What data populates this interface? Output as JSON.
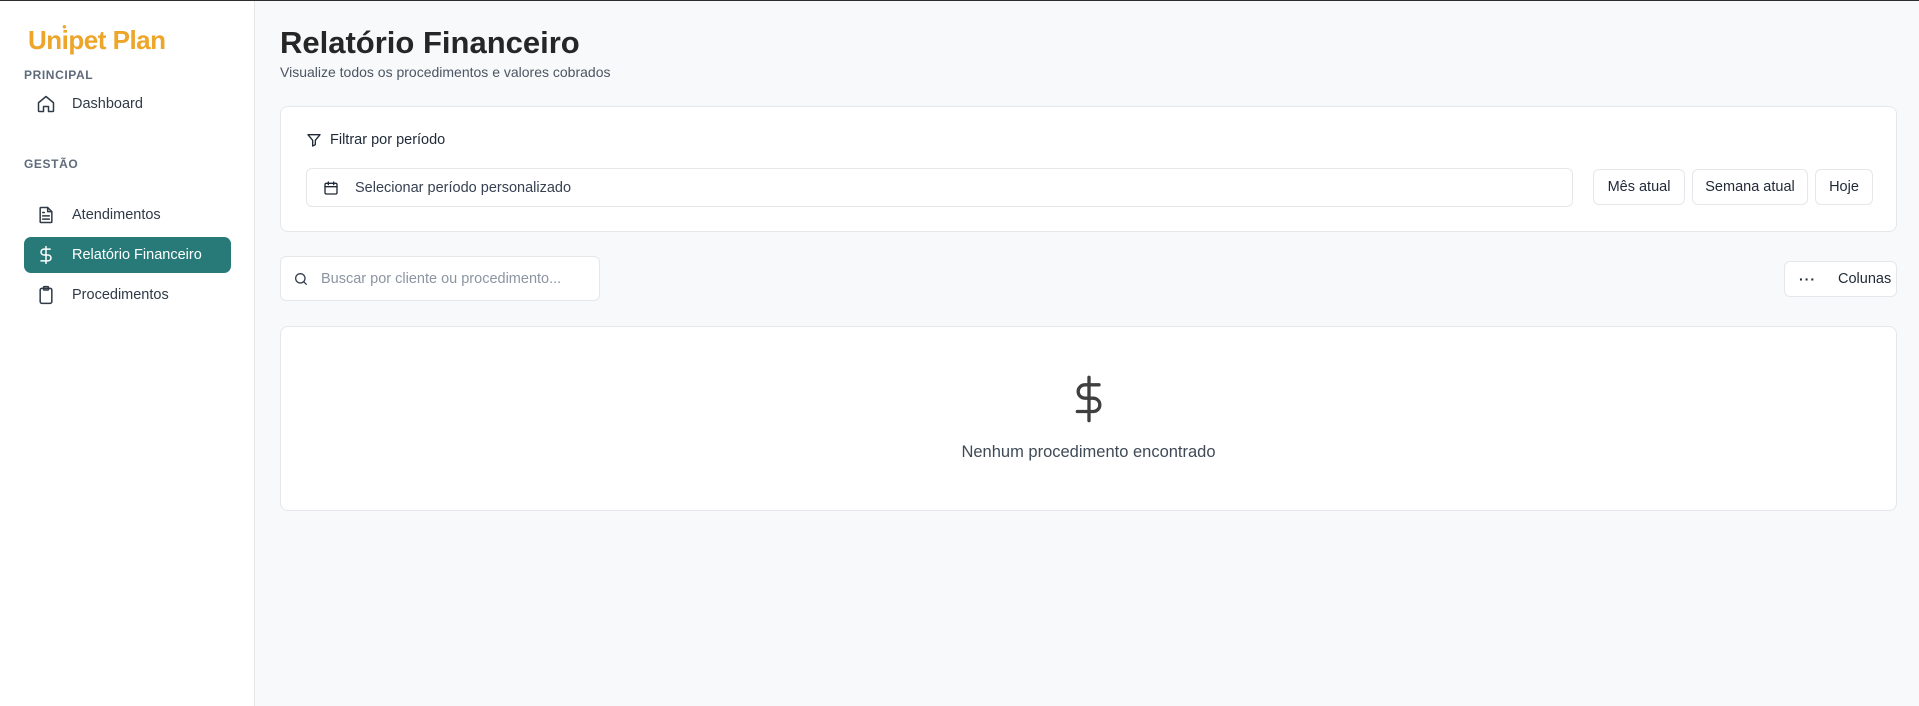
{
  "app": {
    "logo_text": "Unipet Plan"
  },
  "sidebar": {
    "sections": [
      {
        "label": "PRINCIPAL"
      },
      {
        "label": "GESTÃO"
      }
    ],
    "items": [
      {
        "label": "Dashboard",
        "icon": "home-icon",
        "active": false
      },
      {
        "label": "Atendimentos",
        "icon": "document-icon",
        "active": false
      },
      {
        "label": "Relatório Financeiro",
        "icon": "dollar-icon",
        "active": true
      },
      {
        "label": "Procedimentos",
        "icon": "clipboard-icon",
        "active": false
      }
    ]
  },
  "header": {
    "title": "Relatório Financeiro",
    "subtitle": "Visualize todos os procedimentos e valores cobrados"
  },
  "filter": {
    "title": "Filtrar por período",
    "period_placeholder": "Selecionar período personalizado",
    "buttons": [
      "Mês atual",
      "Semana atual",
      "Hoje"
    ]
  },
  "search": {
    "placeholder": "Buscar por cliente ou procedimento...",
    "value": ""
  },
  "columns_button": {
    "label": "Colunas"
  },
  "empty_state": {
    "icon": "dollar-icon",
    "message": "Nenhum procedimento encontrado"
  },
  "colors": {
    "accent": "#277a77",
    "brand": "#eda52a",
    "background": "#f8f9fa"
  }
}
